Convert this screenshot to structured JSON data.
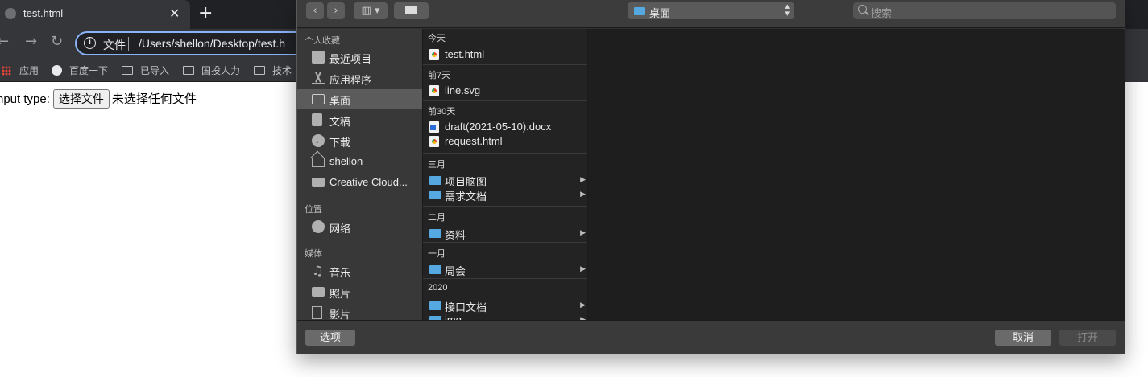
{
  "browser": {
    "tab_title": "test.html",
    "tab_close": "✕",
    "new_tab": "+",
    "back": "←",
    "forward": "→",
    "reload": "↻",
    "omnibox_label": "文件",
    "url": "/Users/shellon/Desktop/test.h",
    "bookmarks": [
      {
        "label": "应用",
        "icon": "apps-grid-icon"
      },
      {
        "label": "百度一下",
        "icon": "globe-icon"
      },
      {
        "label": "已导入",
        "icon": "folder-icon"
      },
      {
        "label": "国投人力",
        "icon": "folder-icon"
      },
      {
        "label": "技术",
        "icon": "folder-icon"
      }
    ]
  },
  "page": {
    "label": "nput type:",
    "file_button": "选择文件",
    "file_status": "未选择任何文件"
  },
  "dialog": {
    "toolbar": {
      "view_button": "▥ ▾",
      "location": "桌面",
      "search_placeholder": "搜索"
    },
    "sidebar": {
      "sections": [
        {
          "heading": "个人收藏",
          "items": [
            {
              "label": "最近项目",
              "icon": "recents-icon",
              "selected": false
            },
            {
              "label": "应用程序",
              "icon": "applications-icon",
              "selected": false
            },
            {
              "label": "桌面",
              "icon": "desktop-icon",
              "selected": true
            },
            {
              "label": "文稿",
              "icon": "documents-icon",
              "selected": false
            },
            {
              "label": "下载",
              "icon": "downloads-icon",
              "selected": false
            },
            {
              "label": "shellon",
              "icon": "home-icon",
              "selected": false
            },
            {
              "label": "Creative Cloud...",
              "icon": "folder-icon",
              "selected": false
            }
          ]
        },
        {
          "heading": "位置",
          "items": [
            {
              "label": "网络",
              "icon": "network-icon",
              "selected": false
            }
          ]
        },
        {
          "heading": "媒体",
          "items": [
            {
              "label": "音乐",
              "icon": "music-icon",
              "selected": false
            },
            {
              "label": "照片",
              "icon": "photos-icon",
              "selected": false
            },
            {
              "label": "影片",
              "icon": "movies-icon",
              "selected": false
            }
          ]
        }
      ]
    },
    "groups": [
      {
        "heading": "今天",
        "items": [
          {
            "name": "test.html",
            "type": "html",
            "folder": false
          }
        ]
      },
      {
        "heading": "前7天",
        "items": [
          {
            "name": "line.svg",
            "type": "html",
            "folder": false
          }
        ]
      },
      {
        "heading": "前30天",
        "items": [
          {
            "name": "draft(2021-05-10).docx",
            "type": "word",
            "folder": false
          },
          {
            "name": "request.html",
            "type": "html",
            "folder": false
          }
        ]
      },
      {
        "heading": "三月",
        "items": [
          {
            "name": "项目脑图",
            "type": "folder",
            "folder": true
          },
          {
            "name": "需求文档",
            "type": "folder",
            "folder": true
          }
        ]
      },
      {
        "heading": "二月",
        "items": [
          {
            "name": "资料",
            "type": "folder",
            "folder": true
          }
        ]
      },
      {
        "heading": "一月",
        "items": [
          {
            "name": "周会",
            "type": "folder",
            "folder": true
          }
        ]
      },
      {
        "heading": "2020",
        "items": [
          {
            "name": "接口文档",
            "type": "folder",
            "folder": true
          },
          {
            "name": "img",
            "type": "folder",
            "folder": true
          }
        ]
      }
    ],
    "footer": {
      "options": "选项",
      "cancel": "取消",
      "open": "打开"
    }
  }
}
